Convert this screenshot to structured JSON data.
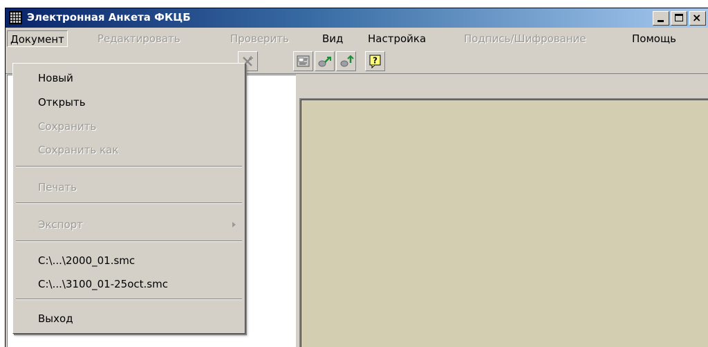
{
  "window": {
    "title": "Электронная Анкета ФКЦБ",
    "minimize_label": "_",
    "close_label": "×"
  },
  "menubar": {
    "items": [
      {
        "label": "Документ",
        "state": "active"
      },
      {
        "label": "Редактировать",
        "state": "disabled"
      },
      {
        "label": "Проверить",
        "state": "disabled"
      },
      {
        "label": "Вид",
        "state": "enabled"
      },
      {
        "label": "Настройка",
        "state": "enabled"
      },
      {
        "label": "Подпись/Шифрование",
        "state": "disabled"
      },
      {
        "label": "Помощь",
        "state": "enabled"
      }
    ]
  },
  "document_menu": {
    "items": [
      {
        "label": "Новый",
        "enabled": true
      },
      {
        "label": "Открыть",
        "enabled": true
      },
      {
        "label": "Сохранить",
        "enabled": false
      },
      {
        "label": "Сохранить как",
        "enabled": false
      },
      {
        "label": "Печать",
        "enabled": false
      },
      {
        "label": "Экспорт",
        "enabled": false,
        "submenu": true
      },
      {
        "label": "C:\\...\\2000_01.smc",
        "enabled": true
      },
      {
        "label": "C:\\...\\3100_01-25oct.smc",
        "enabled": true
      },
      {
        "label": "Выход",
        "enabled": true
      }
    ]
  },
  "toolbar": {
    "buttons": [
      {
        "icon": "cut-icon"
      },
      {
        "icon": "form-icon"
      },
      {
        "icon": "next-icon"
      },
      {
        "icon": "prev-icon"
      },
      {
        "icon": "help-icon",
        "label": "?"
      }
    ]
  },
  "colors": {
    "title_start": "#0a246a",
    "title_end": "#a6caf0",
    "face": "#d4d0c8",
    "workspace": "#d3cdb1",
    "disabled_text": "#9c9a94"
  }
}
